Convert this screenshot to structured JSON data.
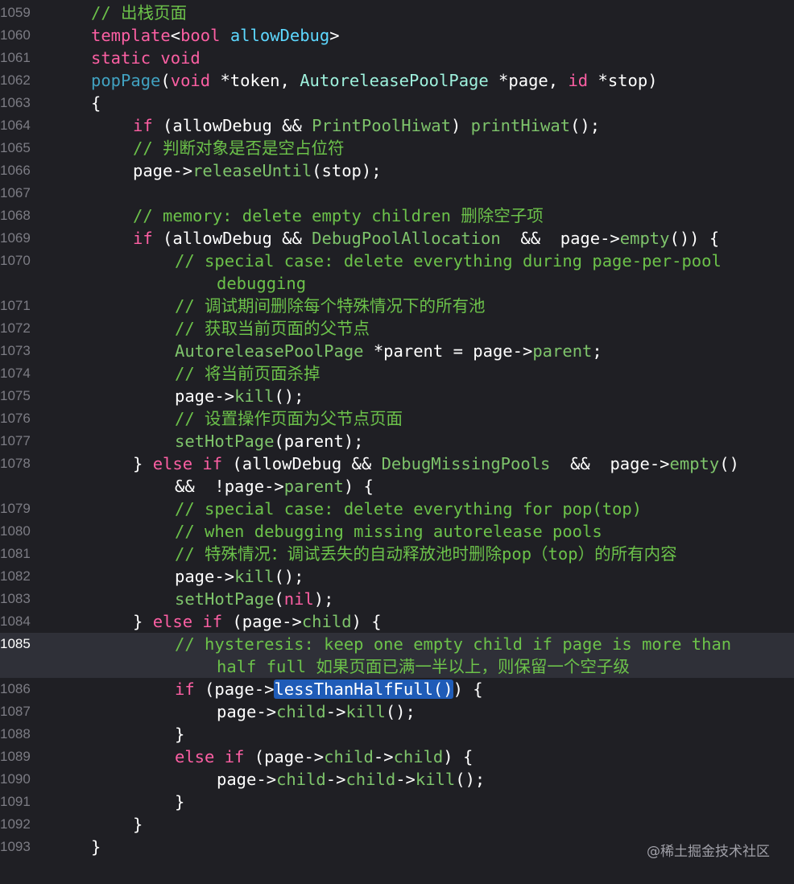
{
  "editor": {
    "current_line": "1085",
    "lines": [
      {
        "num": "1059",
        "indent": 0,
        "tokens": [
          [
            "com",
            "// 出栈页面"
          ]
        ]
      },
      {
        "num": "1060",
        "indent": 0,
        "tokens": [
          [
            "kw",
            "template"
          ],
          [
            "plain",
            "<"
          ],
          [
            "kw",
            "bool"
          ],
          [
            "plain",
            " "
          ],
          [
            "type",
            "allowDebug"
          ],
          [
            "plain",
            ">"
          ]
        ]
      },
      {
        "num": "1061",
        "indent": 0,
        "tokens": [
          [
            "kw",
            "static"
          ],
          [
            "plain",
            " "
          ],
          [
            "kw",
            "void"
          ]
        ]
      },
      {
        "num": "1062",
        "indent": 0,
        "tokens": [
          [
            "fn",
            "popPage"
          ],
          [
            "plain",
            "("
          ],
          [
            "kw",
            "void"
          ],
          [
            "plain",
            " *token, "
          ],
          [
            "cls",
            "AutoreleasePoolPage"
          ],
          [
            "plain",
            " *page, "
          ],
          [
            "kw",
            "id"
          ],
          [
            "plain",
            " *stop)"
          ]
        ]
      },
      {
        "num": "1063",
        "indent": 0,
        "tokens": [
          [
            "plain",
            "{"
          ]
        ]
      },
      {
        "num": "1064",
        "indent": 1,
        "tokens": [
          [
            "kw",
            "if"
          ],
          [
            "plain",
            " (allowDebug && "
          ],
          [
            "green",
            "PrintPoolHiwat"
          ],
          [
            "plain",
            ") "
          ],
          [
            "green",
            "printHiwat"
          ],
          [
            "plain",
            "();"
          ]
        ]
      },
      {
        "num": "1065",
        "indent": 1,
        "tokens": [
          [
            "com",
            "// 判断对象是否是空占位符"
          ]
        ]
      },
      {
        "num": "1066",
        "indent": 1,
        "tokens": [
          [
            "plain",
            "page->"
          ],
          [
            "green",
            "releaseUntil"
          ],
          [
            "plain",
            "(stop);"
          ]
        ]
      },
      {
        "num": "1067",
        "indent": 0,
        "tokens": []
      },
      {
        "num": "1068",
        "indent": 1,
        "tokens": [
          [
            "com",
            "// memory: delete empty children 删除空子项"
          ]
        ]
      },
      {
        "num": "1069",
        "indent": 1,
        "tokens": [
          [
            "kw",
            "if"
          ],
          [
            "plain",
            " (allowDebug && "
          ],
          [
            "green",
            "DebugPoolAllocation"
          ],
          [
            "plain",
            "  &&  page->"
          ],
          [
            "green",
            "empty"
          ],
          [
            "plain",
            "()) {"
          ]
        ]
      },
      {
        "num": "1070",
        "indent": 2,
        "tokens": [
          [
            "com",
            "// special case: delete everything during page-per-pool"
          ]
        ]
      },
      {
        "num": "",
        "indent": 3,
        "tokens": [
          [
            "com",
            "debugging"
          ]
        ]
      },
      {
        "num": "1071",
        "indent": 2,
        "tokens": [
          [
            "com",
            "// 调试期间删除每个特殊情况下的所有池"
          ]
        ]
      },
      {
        "num": "1072",
        "indent": 2,
        "tokens": [
          [
            "com",
            "// 获取当前页面的父节点"
          ]
        ]
      },
      {
        "num": "1073",
        "indent": 2,
        "tokens": [
          [
            "green",
            "AutoreleasePoolPage"
          ],
          [
            "plain",
            " *parent = page->"
          ],
          [
            "green",
            "parent"
          ],
          [
            "plain",
            ";"
          ]
        ]
      },
      {
        "num": "1074",
        "indent": 2,
        "tokens": [
          [
            "com",
            "// 将当前页面杀掉"
          ]
        ]
      },
      {
        "num": "1075",
        "indent": 2,
        "tokens": [
          [
            "plain",
            "page->"
          ],
          [
            "green",
            "kill"
          ],
          [
            "plain",
            "();"
          ]
        ]
      },
      {
        "num": "1076",
        "indent": 2,
        "tokens": [
          [
            "com",
            "// 设置操作页面为父节点页面"
          ]
        ]
      },
      {
        "num": "1077",
        "indent": 2,
        "tokens": [
          [
            "green",
            "setHotPage"
          ],
          [
            "plain",
            "(parent);"
          ]
        ]
      },
      {
        "num": "1078",
        "indent": 1,
        "tokens": [
          [
            "plain",
            "} "
          ],
          [
            "kw",
            "else"
          ],
          [
            "plain",
            " "
          ],
          [
            "kw",
            "if"
          ],
          [
            "plain",
            " (allowDebug && "
          ],
          [
            "green",
            "DebugMissingPools"
          ],
          [
            "plain",
            "  &&  page->"
          ],
          [
            "green",
            "empty"
          ],
          [
            "plain",
            "()"
          ]
        ]
      },
      {
        "num": "",
        "indent": 2,
        "tokens": [
          [
            "plain",
            "&&  !page->"
          ],
          [
            "green",
            "parent"
          ],
          [
            "plain",
            ") {"
          ]
        ]
      },
      {
        "num": "1079",
        "indent": 2,
        "tokens": [
          [
            "com",
            "// special case: delete everything for pop(top)"
          ]
        ]
      },
      {
        "num": "1080",
        "indent": 2,
        "tokens": [
          [
            "com",
            "// when debugging missing autorelease pools"
          ]
        ]
      },
      {
        "num": "1081",
        "indent": 2,
        "tokens": [
          [
            "com",
            "// 特殊情况：调试丢失的自动释放池时删除pop（top）的所有内容"
          ]
        ]
      },
      {
        "num": "1082",
        "indent": 2,
        "tokens": [
          [
            "plain",
            "page->"
          ],
          [
            "green",
            "kill"
          ],
          [
            "plain",
            "();"
          ]
        ]
      },
      {
        "num": "1083",
        "indent": 2,
        "tokens": [
          [
            "green",
            "setHotPage"
          ],
          [
            "plain",
            "("
          ],
          [
            "kw",
            "nil"
          ],
          [
            "plain",
            ");"
          ]
        ]
      },
      {
        "num": "1084",
        "indent": 1,
        "tokens": [
          [
            "plain",
            "} "
          ],
          [
            "kw",
            "else"
          ],
          [
            "plain",
            " "
          ],
          [
            "kw",
            "if"
          ],
          [
            "plain",
            " (page->"
          ],
          [
            "green",
            "child"
          ],
          [
            "plain",
            ") {"
          ]
        ]
      },
      {
        "num": "1085",
        "indent": 2,
        "current": true,
        "tokens": [
          [
            "com",
            "// hysteresis: keep one empty child if page is more than"
          ]
        ]
      },
      {
        "num": "",
        "indent": 3,
        "current": true,
        "tokens": [
          [
            "com",
            "half full 如果页面已满一半以上，则保留一个空子级"
          ]
        ]
      },
      {
        "num": "1086",
        "indent": 2,
        "tokens": [
          [
            "kw",
            "if"
          ],
          [
            "plain",
            " (page->"
          ],
          [
            "sel",
            "lessThanHalfFull()"
          ],
          [
            "plain",
            ") {"
          ]
        ]
      },
      {
        "num": "1087",
        "indent": 3,
        "tokens": [
          [
            "plain",
            "page->"
          ],
          [
            "green",
            "child"
          ],
          [
            "plain",
            "->"
          ],
          [
            "green",
            "kill"
          ],
          [
            "plain",
            "();"
          ]
        ]
      },
      {
        "num": "1088",
        "indent": 2,
        "tokens": [
          [
            "plain",
            "}"
          ]
        ]
      },
      {
        "num": "1089",
        "indent": 2,
        "tokens": [
          [
            "kw",
            "else"
          ],
          [
            "plain",
            " "
          ],
          [
            "kw",
            "if"
          ],
          [
            "plain",
            " (page->"
          ],
          [
            "green",
            "child"
          ],
          [
            "plain",
            "->"
          ],
          [
            "green",
            "child"
          ],
          [
            "plain",
            ") {"
          ]
        ]
      },
      {
        "num": "1090",
        "indent": 3,
        "tokens": [
          [
            "plain",
            "page->"
          ],
          [
            "green",
            "child"
          ],
          [
            "plain",
            "->"
          ],
          [
            "green",
            "child"
          ],
          [
            "plain",
            "->"
          ],
          [
            "green",
            "kill"
          ],
          [
            "plain",
            "();"
          ]
        ]
      },
      {
        "num": "1091",
        "indent": 2,
        "tokens": [
          [
            "plain",
            "}"
          ]
        ]
      },
      {
        "num": "1092",
        "indent": 1,
        "tokens": [
          [
            "plain",
            "}"
          ]
        ]
      },
      {
        "num": "1093",
        "indent": 0,
        "tokens": [
          [
            "plain",
            "}"
          ]
        ]
      }
    ]
  },
  "watermark": "@稀土掘金技术社区"
}
